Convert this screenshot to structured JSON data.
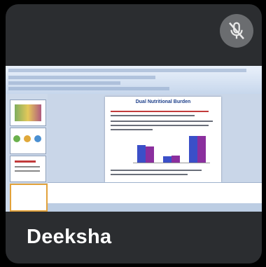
{
  "participant": {
    "name": "Deeksha",
    "mic_status": "muted",
    "mic_icon": "mic-off-icon"
  },
  "shared_screen": {
    "slide": {
      "title": "Dual Nutritional Burden",
      "chart_data": {
        "type": "bar",
        "categories": [
          "",
          "",
          ""
        ],
        "series": [
          {
            "values": [
              22,
              8,
              33
            ],
            "color": "#3b4fc8"
          },
          {
            "values": [
              20,
              9,
              33
            ],
            "color": "#8b2f9e"
          }
        ]
      }
    }
  },
  "colors": {
    "tile_bg": "#2b2d30",
    "mute_bg": "#6b6d70"
  }
}
